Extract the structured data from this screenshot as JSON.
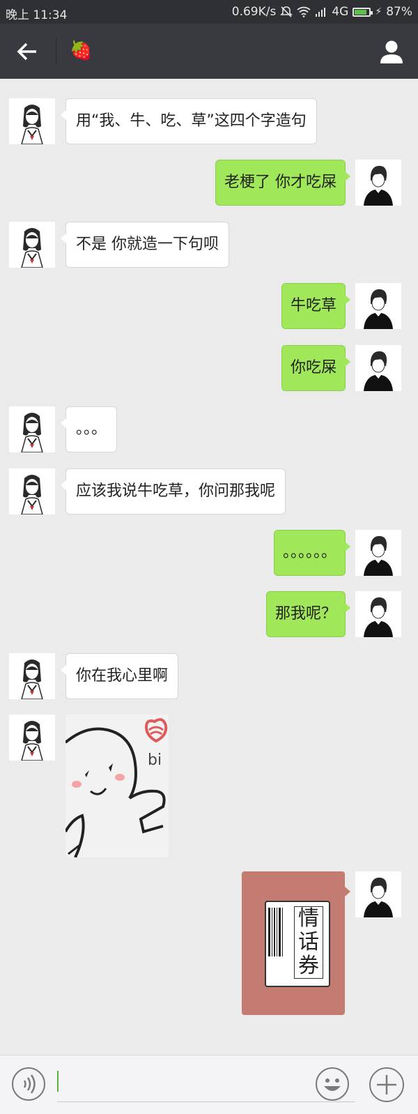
{
  "status_bar": {
    "time": "晚上 11:34",
    "net_speed": "0.69K/s",
    "signal": "4G",
    "battery": "87%",
    "battery_level": 0.87
  },
  "header": {
    "back_icon": "arrow-left-icon",
    "title_emoji": "🍓",
    "profile_icon": "person-icon"
  },
  "messages": [
    {
      "side": "in",
      "text": "用“我、牛、吃、草”这四个字造句"
    },
    {
      "side": "out",
      "text": "老梗了 你才吃屎"
    },
    {
      "side": "in",
      "text": "不是 你就造一下句呗"
    },
    {
      "side": "out",
      "text": "牛吃草"
    },
    {
      "side": "out",
      "text": "你吃屎"
    },
    {
      "side": "in",
      "text": "。。。"
    },
    {
      "side": "in",
      "text": "应该我说牛吃草，你问那我呢"
    },
    {
      "side": "out",
      "text": "。。。。。。"
    },
    {
      "side": "out",
      "text": "那我呢？"
    },
    {
      "side": "in",
      "text": "你在我心里啊"
    },
    {
      "side": "in",
      "type": "sticker",
      "sticker_text": "bi"
    },
    {
      "side": "out",
      "type": "ticket",
      "ticket_text": [
        "情",
        "话",
        "券"
      ]
    }
  ],
  "input_bar": {
    "voice_icon": "voice-icon",
    "emoji_icon": "smile-icon",
    "plus_icon": "plus-icon"
  },
  "colors": {
    "outgoing_bubble": "#a0e75a",
    "incoming_bubble": "#ffffff",
    "header_bg": "#393a3f",
    "ticket_bg": "#c47c72"
  }
}
